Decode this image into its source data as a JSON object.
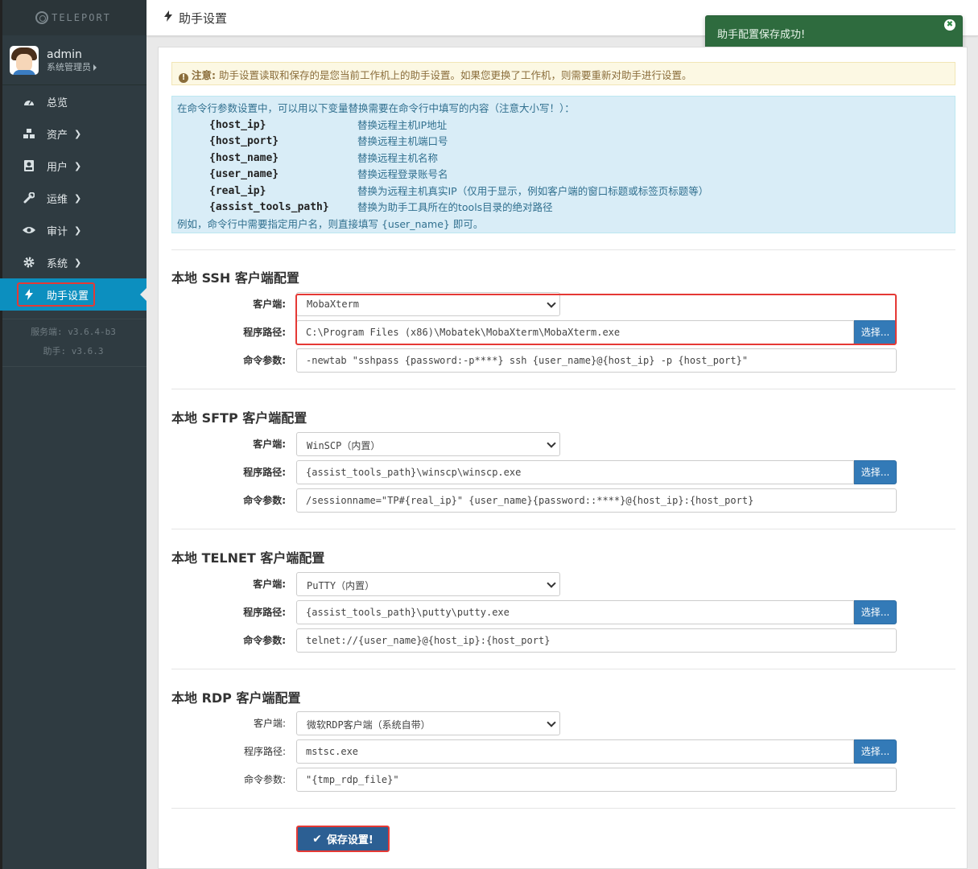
{
  "app": {
    "logo_text": "TELEPORT"
  },
  "user": {
    "name": "admin",
    "role": "系统管理员"
  },
  "sidebar": {
    "items": [
      {
        "label": "总览",
        "icon": "dashboard-icon",
        "has_arrow": false
      },
      {
        "label": "资产",
        "icon": "cubes-icon",
        "has_arrow": true
      },
      {
        "label": "用户",
        "icon": "user-card-icon",
        "has_arrow": true
      },
      {
        "label": "运维",
        "icon": "wrench-icon",
        "has_arrow": true
      },
      {
        "label": "审计",
        "icon": "eye-icon",
        "has_arrow": true
      },
      {
        "label": "系统",
        "icon": "gear-icon",
        "has_arrow": true
      },
      {
        "label": "助手设置",
        "icon": "bolt-icon",
        "has_arrow": false,
        "active": true
      }
    ],
    "versions": {
      "server": "服务端: v3.6.4-b3",
      "assist": "助手: v3.6.3"
    }
  },
  "header": {
    "title": "助手设置"
  },
  "toast": {
    "message": "助手配置保存成功!"
  },
  "notice": {
    "label": "注意:",
    "text": "助手设置读取和保存的是您当前工作机上的助手设置。如果您更换了工作机，则需要重新对助手进行设置。"
  },
  "info": {
    "intro": "在命令行参数设置中，可以用以下变量替换需要在命令行中填写的内容（注意大小写！）：",
    "vars": [
      {
        "name": "{host_ip}",
        "desc": "替换远程主机IP地址"
      },
      {
        "name": "{host_port}",
        "desc": "替换远程主机端口号"
      },
      {
        "name": "{host_name}",
        "desc": "替换远程主机名称"
      },
      {
        "name": "{user_name}",
        "desc": "替换远程登录账号名"
      },
      {
        "name": "{real_ip}",
        "desc": "替换为远程主机真实IP（仅用于显示，例如客户端的窗口标题或标签页标题等）"
      },
      {
        "name": "{assist_tools_path}",
        "desc": "替换为助手工具所在的tools目录的绝对路径"
      }
    ],
    "example": "例如，命令行中需要指定用户名，则直接填写 {user_name} 即可。"
  },
  "labels": {
    "client": "客户端:",
    "path": "程序路径:",
    "args": "命令参数:",
    "choose": "选择..."
  },
  "sections": {
    "ssh": {
      "title": "本地 SSH 客户端配置",
      "client": "MobaXterm",
      "path": "C:\\Program Files (x86)\\Mobatek\\MobaXterm\\MobaXterm.exe",
      "args": "-newtab \"sshpass {password:-p****} ssh {user_name}@{host_ip} -p {host_port}\""
    },
    "sftp": {
      "title": "本地 SFTP 客户端配置",
      "client": "WinSCP（内置）",
      "path": "{assist_tools_path}\\winscp\\winscp.exe",
      "args": "/sessionname=\"TP#{real_ip}\" {user_name}{password::****}@{host_ip}:{host_port}"
    },
    "telnet": {
      "title": "本地 TELNET 客户端配置",
      "client": "PuTTY（内置）",
      "path": "{assist_tools_path}\\putty\\putty.exe",
      "args": "telnet://{user_name}@{host_ip}:{host_port}"
    },
    "rdp": {
      "title": "本地 RDP 客户端配置",
      "client": "微软RDP客户端（系统自带）",
      "path": "mstsc.exe",
      "args": "\"{tmp_rdp_file}\""
    }
  },
  "save": {
    "label": "保存设置!"
  },
  "colors": {
    "sidebar": "#2f3b41",
    "active": "#0c8fbf",
    "primary": "#337ab7",
    "highlight": "#e53935",
    "toast": "#2e6b3e"
  }
}
